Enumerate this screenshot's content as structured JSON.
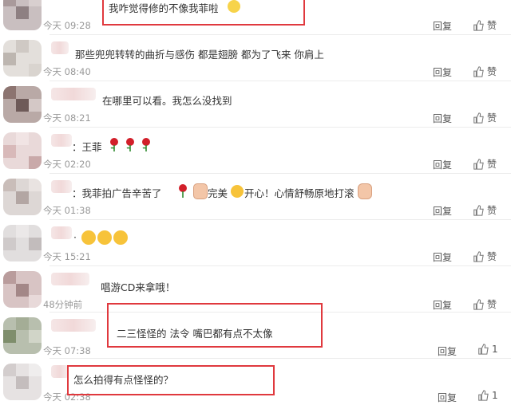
{
  "comments": [
    {
      "text": "我咋觉得修的不像我菲啦",
      "time": "今天 09:28",
      "reply": "回复",
      "like": "赞"
    },
    {
      "text": "那些兜兜转转的曲折与感伤 都是翅膀 都为了飞来 你肩上",
      "time": "今天 08:40",
      "reply": "回复",
      "like": "赞"
    },
    {
      "text": "在哪里可以看。我怎么没找到",
      "time": "今天 08:21",
      "reply": "回复",
      "like": "赞"
    },
    {
      "text": "：王菲",
      "time": "今天 02:20",
      "reply": "回复",
      "like": "赞"
    },
    {
      "text": "：我菲拍广告辛苦了",
      "text2": "完美",
      "text3": "开心！心情舒畅原地打滚",
      "time": "今天 01:38",
      "reply": "回复",
      "like": "赞"
    },
    {
      "text": "·",
      "time": "今天 15:21",
      "reply": "回复",
      "like": "赞"
    },
    {
      "text": "唱游CD来拿哦！",
      "time": "48分钟前",
      "reply": "回复",
      "like": "赞"
    },
    {
      "text": "二三怪怪的 法令 嘴巴都有点不太像",
      "time": "今天 07:38",
      "reply": "回复",
      "like": "1"
    },
    {
      "text": "怎么拍得有点怪怪的？",
      "time": "今天 02:38",
      "reply": "回复",
      "like": "1"
    }
  ],
  "colors": {
    "highlight": "#e0393e",
    "rose": "#d21f2a",
    "heart_face": "#f7c33a"
  }
}
